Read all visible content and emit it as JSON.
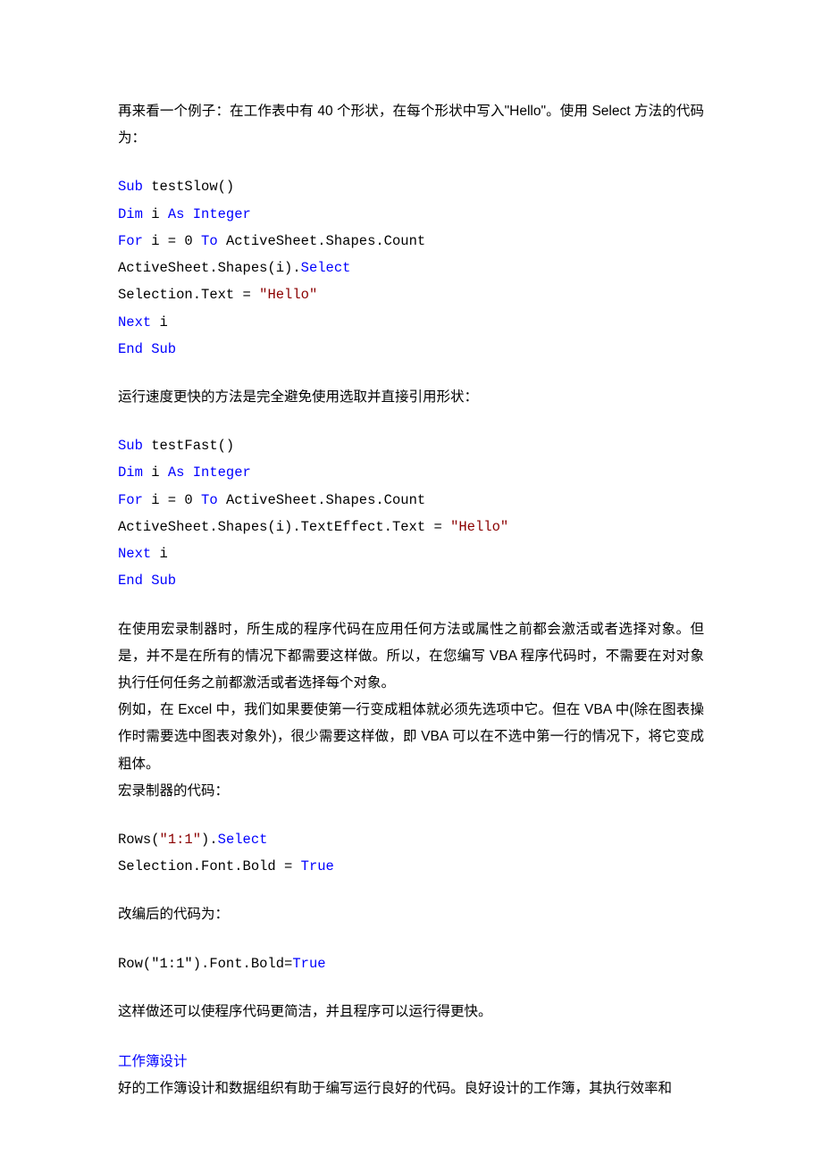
{
  "para1": "再来看一个例子：在工作表中有 40 个形状，在每个形状中写入\"Hello\"。使用 Select 方法的代码为：",
  "code1": {
    "l1_a": "Sub",
    "l1_b": " testSlow()",
    "l2_a": "Dim",
    "l2_b": " i ",
    "l2_c": "As Integer",
    "l3_a": "For",
    "l3_b": " i = 0 ",
    "l3_c": "To",
    "l3_d": " ActiveSheet.Shapes.Count",
    "l4": "ActiveSheet.Shapes(i).",
    "l4_b": "Select",
    "l5_a": "Selection.Text = ",
    "l5_b": "\"Hello\"",
    "l6_a": "Next",
    "l6_b": " i",
    "l7": "End Sub"
  },
  "para2": "运行速度更快的方法是完全避免使用选取并直接引用形状：",
  "code2": {
    "l1_a": "Sub",
    "l1_b": " testFast()",
    "l2_a": "Dim",
    "l2_b": " i ",
    "l2_c": "As Integer",
    "l3_a": "For",
    "l3_b": " i = 0 ",
    "l3_c": "To",
    "l3_d": " ActiveSheet.Shapes.Count",
    "l4_a": "ActiveSheet.Shapes(i).TextEffect.Text = ",
    "l4_b": "\"Hello\"",
    "l5_a": "Next",
    "l5_b": " i",
    "l6": "End Sub"
  },
  "para3a": "在使用宏录制器时，所生成的程序代码在应用任何方法或属性之前都会激活或者选择对象。但是，并不是在所有的情况下都需要这样做。所以，在您编写 VBA 程序代码时，不需要在对对象执行任何任务之前都激活或者选择每个对象。",
  "para3b": "例如，在 Excel 中，我们如果要使第一行变成粗体就必须先选项中它。但在 VBA 中(除在图表操作时需要选中图表对象外)，很少需要这样做，即 VBA 可以在不选中第一行的情况下，将它变成粗体。",
  "para3c": "宏录制器的代码：",
  "code3": {
    "l1_a": "Rows(",
    "l1_b": "\"1:1\"",
    "l1_c": ").",
    "l1_d": "Select",
    "l2_a": "Selection.Font.Bold = ",
    "l2_b": "True"
  },
  "para4": "改编后的代码为：",
  "code4": {
    "l1_a": "Row(\"1:1\").Font.Bold=",
    "l1_b": "True"
  },
  "para5": "这样做还可以使程序代码更简洁，并且程序可以运行得更快。",
  "heading1": "工作簿设计",
  "para6": "好的工作簿设计和数据组织有助于编写运行良好的代码。良好设计的工作簿，其执行效率和"
}
